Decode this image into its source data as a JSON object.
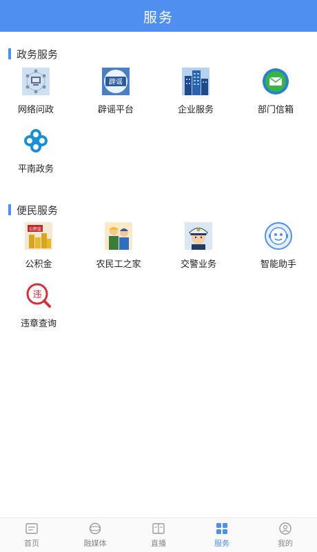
{
  "header": {
    "title": "服务"
  },
  "sections": [
    {
      "title": "政务服务",
      "items": [
        {
          "label": "网络问政",
          "icon": "network-inquiry-icon"
        },
        {
          "label": "辟谣平台",
          "icon": "rumor-refute-icon"
        },
        {
          "label": "企业服务",
          "icon": "enterprise-building-icon"
        },
        {
          "label": "部门信箱",
          "icon": "mail-icon"
        },
        {
          "label": "平南政务",
          "icon": "government-clover-icon"
        }
      ]
    },
    {
      "title": "便民服务",
      "items": [
        {
          "label": "公积金",
          "icon": "provident-fund-icon"
        },
        {
          "label": "农民工之家",
          "icon": "migrant-worker-icon"
        },
        {
          "label": "交警业务",
          "icon": "traffic-police-icon"
        },
        {
          "label": "智能助手",
          "icon": "robot-assistant-icon"
        },
        {
          "label": "违章查询",
          "icon": "violation-search-icon"
        }
      ]
    }
  ],
  "tabbar": {
    "tabs": [
      {
        "label": "首页",
        "icon": "home-icon"
      },
      {
        "label": "融媒体",
        "icon": "media-icon"
      },
      {
        "label": "直播",
        "icon": "live-icon"
      },
      {
        "label": "服务",
        "icon": "service-grid-icon"
      },
      {
        "label": "我的",
        "icon": "profile-icon"
      }
    ],
    "active": "服务"
  },
  "colors": {
    "accent": "#4f8ff0",
    "header_text": "#ffffff"
  }
}
